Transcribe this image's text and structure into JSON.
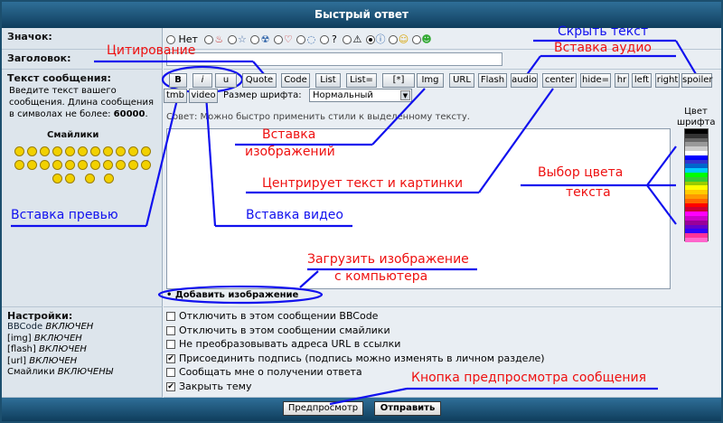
{
  "header": {
    "title": "Быстрый ответ"
  },
  "icons_row": {
    "label": "Значок:",
    "none_label": "Нет"
  },
  "subject_row": {
    "label": "Заголовок:",
    "value": ""
  },
  "message": {
    "label": "Текст сообщения:",
    "description_pre": "Введите текст вашего сообщения. Длина сообщения в символах не более:",
    "max_len": "60000",
    "smilies_title": "Смайлики",
    "hint": "Совет: Можно быстро применить стили к выделенному тексту.",
    "color_label": "Цвет шрифта",
    "font_size_label": "Размер шрифта:",
    "font_size_value": "Нормальный",
    "add_image": "Добавить изображение",
    "buttons_row1": [
      "B",
      "i",
      "u",
      "Quote",
      "Code",
      "List",
      "List=",
      "[*]",
      "Img",
      "URL",
      "Flash",
      "audio",
      "center",
      "hide=",
      "hr",
      "left",
      "right",
      "spoiler"
    ],
    "buttons_row2": [
      "tmb",
      "video"
    ]
  },
  "settings": {
    "label": "Настройки:",
    "status": [
      {
        "name": "BBCode",
        "state": "ВКЛЮЧЕН"
      },
      {
        "name": "[img]",
        "state": "ВКЛЮЧЕН"
      },
      {
        "name": "[flash]",
        "state": "ВКЛЮЧЕН"
      },
      {
        "name": "[url]",
        "state": "ВКЛЮЧЕН"
      },
      {
        "name": "Смайлики",
        "state": "ВКЛЮЧЕНЫ"
      }
    ],
    "options": [
      {
        "label": "Отключить в этом сообщении BBCode",
        "checked": false
      },
      {
        "label": "Отключить в этом сообщении смайлики",
        "checked": false
      },
      {
        "label": "Не преобразовывать адреса URL в ссылки",
        "checked": false
      },
      {
        "label": "Присоединить подпись (подпись можно изменять в личном разделе)",
        "checked": true
      },
      {
        "label": "Сообщать мне о получении ответа",
        "checked": false
      },
      {
        "label": "Закрыть тему",
        "checked": true
      }
    ]
  },
  "footer": {
    "preview": "Предпросмотр",
    "submit": "Отправить"
  },
  "annotations": {
    "quote": "Цитирование",
    "hide": "Скрыть текст",
    "audio": "Вставка аудио",
    "img1": "Вставка",
    "img2": "изображений",
    "center": "Центрирует текст и картинки",
    "color1": "Выбор цвета",
    "color2": "текста",
    "tmb": "Вставка превью",
    "video": "Вставка видео",
    "upload1": "Загрузить изображение",
    "upload2": "с компьютера",
    "preview": "Кнопка предпросмотра сообщения"
  },
  "colors": {
    "header": "#1c4f6e",
    "annotation_blue": "#1111ee",
    "annotation_red": "#ee1111",
    "panel": "#e9eef3"
  }
}
